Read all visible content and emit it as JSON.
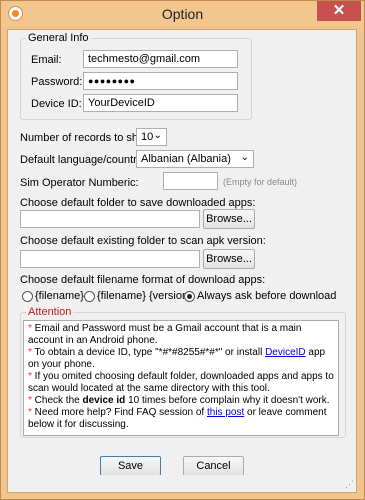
{
  "window": {
    "title": "Option",
    "close": "✕"
  },
  "general": {
    "legend": "General Info",
    "email_label": "Email:",
    "email_value": "techmesto@gmail.com",
    "password_label": "Password:",
    "password_value": "●●●●●●●●",
    "device_label": "Device ID:",
    "device_value": "YourDeviceID"
  },
  "settings": {
    "records_label": "Number of records  to show:",
    "records_value": "10",
    "language_label": "Default language/country:",
    "language_value": "Albanian (Albania)",
    "sim_label": "Sim Operator Numberic:",
    "sim_value": "",
    "sim_hint": "(Empty for default)",
    "download_folder_label": "Choose default folder to save downloaded apps:",
    "download_folder_value": "",
    "scan_folder_label": "Choose default existing folder to scan apk version:",
    "scan_folder_value": "",
    "browse_label": "Browse...",
    "filename_label": "Choose default filename format of download apps:",
    "radio_options": [
      "{filename}",
      "{filename} {version}",
      "Always ask before download"
    ]
  },
  "attention": {
    "legend": "Attention",
    "line1_a": "Email and Password must be a Gmail account that is a main account in an Android phone.",
    "line2_a": "To obtain a device ID, type \"*#*#8255#*#*\" or install ",
    "line2_link": "DeviceID",
    "line2_b": " app on your phone.",
    "line3_a": "If you omited choosing default folder, downloaded apps and apps to scan would located at the same directory with this tool.",
    "line4_a": "Check the ",
    "line4_bold": "device id",
    "line4_b": " 10 times before complain why it doesn't work.",
    "line5_a": "Need more help? Find FAQ session of ",
    "line5_link": "this post",
    "line5_b": " or leave comment below it for discussing."
  },
  "footer": {
    "save_label": "Save",
    "cancel_label": "Cancel"
  }
}
